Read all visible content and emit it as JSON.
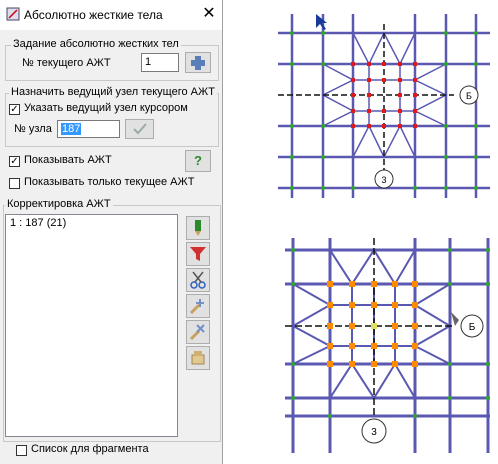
{
  "dialog": {
    "title": "Абсолютно жесткие тела",
    "group_create": {
      "label": "Задание абсолютно жестких тел",
      "current_label": "№ текущего АЖТ",
      "current_value": "1"
    },
    "group_master": {
      "label": "Назначить ведущий узел текущего АЖТ",
      "cursor_checkbox_label": "Указать ведущий узел курсором",
      "cursor_checked": true,
      "node_label": "№ узла",
      "node_value": "187"
    },
    "show_checkbox_label": "Показывать АЖТ",
    "show_checked": true,
    "show_current_label": "Показывать только текущее АЖТ",
    "show_current_checked": false,
    "help_icon_text": "?",
    "correction": {
      "label": "Корректировка АЖТ",
      "items": [
        "1 : 187 (21)"
      ]
    },
    "fragment_checkbox_label": "Список для фрагмента",
    "fragment_checked": false
  },
  "views": {
    "top": {
      "circle_right": "Б",
      "circle_bottom": "3"
    },
    "bottom": {
      "circle_right": "Б",
      "circle_bottom": "3"
    }
  },
  "colors": {
    "grid": "#5a58b0",
    "hinge_top": "#e01a1a",
    "hinge_bottom": "#ff8c00",
    "node": "#2aa82a"
  }
}
